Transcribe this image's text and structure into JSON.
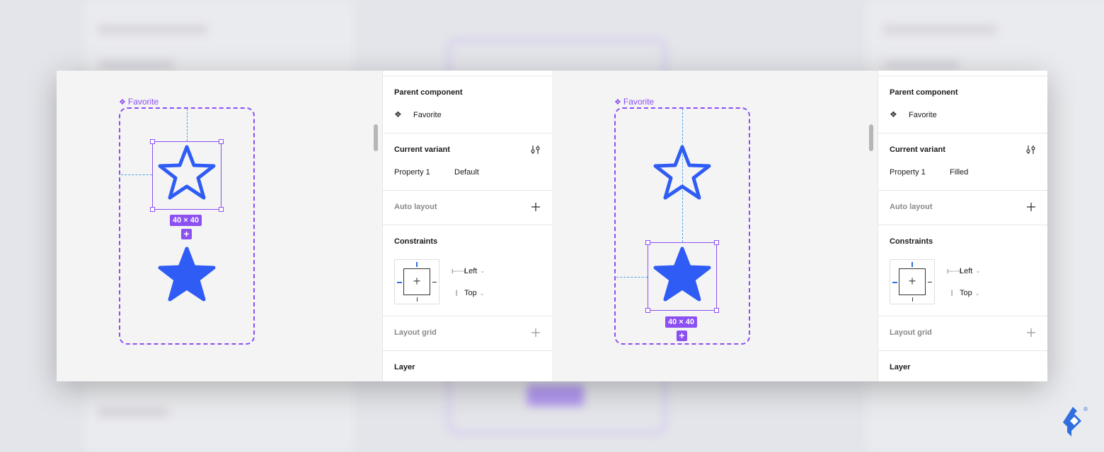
{
  "colors": {
    "accent": "#8b4ff2",
    "star": "#2f5cf5",
    "guide": "#4aa3e6",
    "constraint_active": "#2f6fe0"
  },
  "background_ghost": {
    "left_title": "Parent component",
    "left_row": "Favorite",
    "right_title": "Parent component",
    "right_row": "Favorite"
  },
  "frames": [
    {
      "canvas": {
        "component_label": "Favorite",
        "component_icon": "component-icon",
        "size_badge": "40 × 40",
        "plus_badge": "+"
      },
      "panel": {
        "parent_component": {
          "title": "Parent component",
          "name": "Favorite"
        },
        "current_variant": {
          "title": "Current variant",
          "property": "Property 1",
          "value": "Default"
        },
        "auto_layout": {
          "title": "Auto layout"
        },
        "constraints": {
          "title": "Constraints",
          "horizontal": "Left",
          "vertical": "Top"
        },
        "layout_grid": {
          "title": "Layout grid"
        },
        "layer": {
          "title": "Layer"
        }
      }
    },
    {
      "canvas": {
        "component_label": "Favorite",
        "component_icon": "component-icon",
        "size_badge": "40 × 40",
        "plus_badge": "+"
      },
      "panel": {
        "parent_component": {
          "title": "Parent component",
          "name": "Favorite"
        },
        "current_variant": {
          "title": "Current variant",
          "property": "Property 1",
          "value": "Filled"
        },
        "auto_layout": {
          "title": "Auto layout"
        },
        "constraints": {
          "title": "Constraints",
          "horizontal": "Left",
          "vertical": "Top"
        },
        "layout_grid": {
          "title": "Layout grid"
        },
        "layer": {
          "title": "Layer"
        }
      }
    }
  ],
  "logo": {
    "mark": "toptal-logo",
    "registered": "®"
  }
}
